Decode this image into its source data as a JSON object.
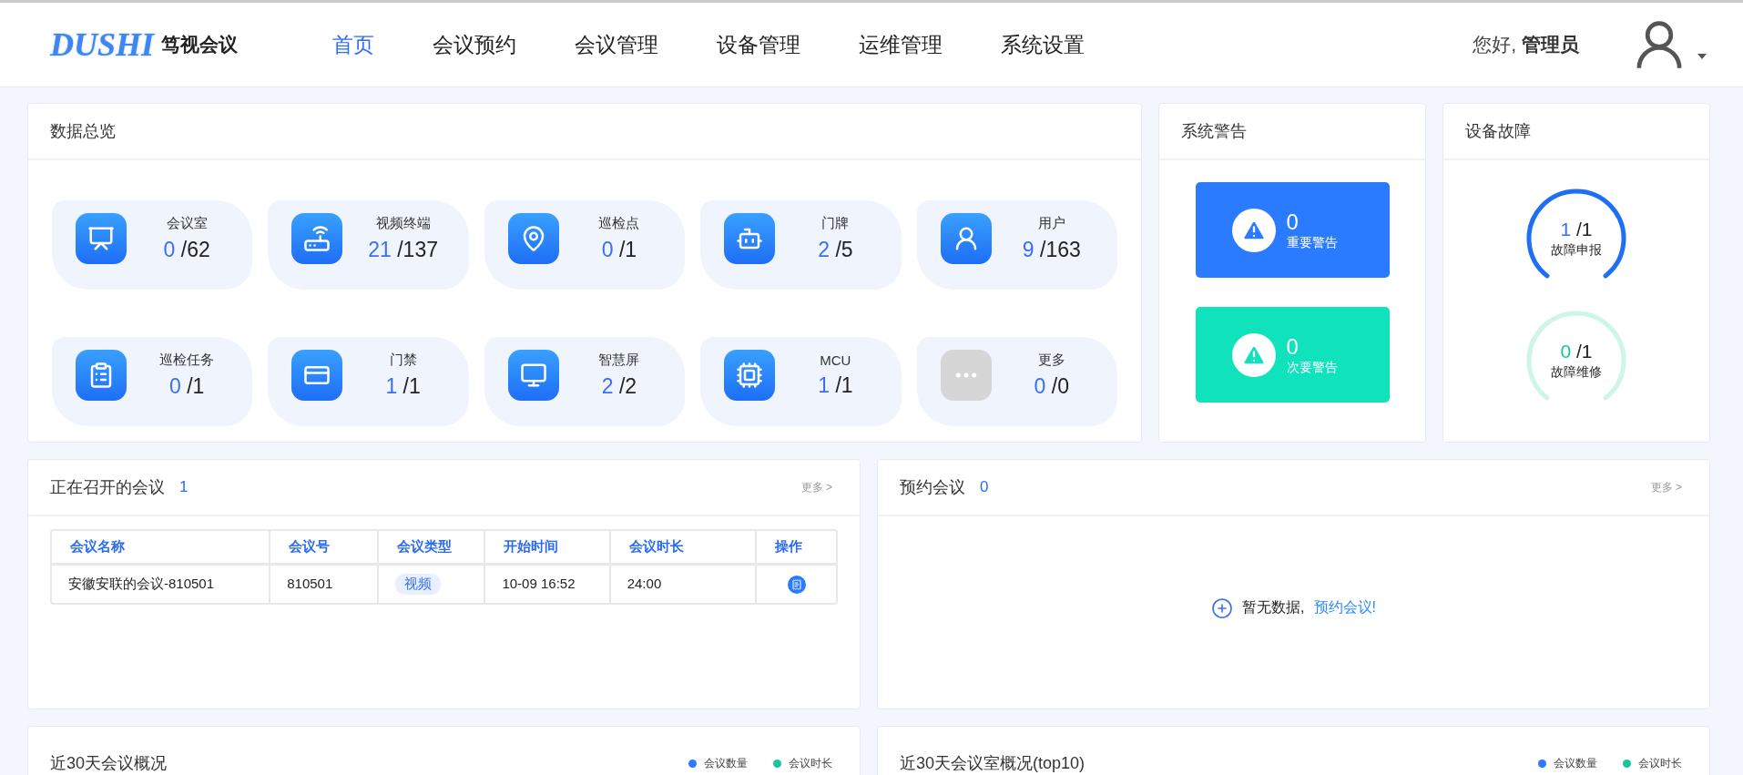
{
  "header": {
    "logo_mark": "DUSHI",
    "logo_text": "笃视会议",
    "nav": [
      {
        "label": "首页",
        "selected": true
      },
      {
        "label": "会议预约",
        "selected": false
      },
      {
        "label": "会议管理",
        "selected": false
      },
      {
        "label": "设备管理",
        "selected": false
      },
      {
        "label": "运维管理",
        "selected": false
      },
      {
        "label": "系统设置",
        "selected": false
      }
    ],
    "greeting": "您好,",
    "user": "管理员"
  },
  "overview": {
    "title": "数据总览",
    "stats": [
      {
        "kind": "room",
        "label": "会议室",
        "current": "0",
        "total": "/62"
      },
      {
        "kind": "terminal",
        "label": "视频终端",
        "current": "21",
        "total": "/137"
      },
      {
        "kind": "checkpoint",
        "label": "巡检点",
        "current": "0",
        "total": "/1"
      },
      {
        "kind": "doorplate",
        "label": "门牌",
        "current": "2",
        "total": "/5"
      },
      {
        "kind": "user",
        "label": "用户",
        "current": "9",
        "total": "/163"
      },
      {
        "kind": "task",
        "label": "巡检任务",
        "current": "0",
        "total": "/1"
      },
      {
        "kind": "access",
        "label": "门禁",
        "current": "1",
        "total": "/1"
      },
      {
        "kind": "screen",
        "label": "智慧屏",
        "current": "2",
        "total": "/2"
      },
      {
        "kind": "mcu",
        "label": "MCU",
        "current": "1",
        "total": "/1"
      },
      {
        "kind": "more",
        "label": "更多",
        "current": "0",
        "total": "/0"
      }
    ]
  },
  "alerts": {
    "title": "系统警告",
    "items": [
      {
        "color": "#2a7bff",
        "count": "0",
        "label": "重要警告"
      },
      {
        "color": "#10e2bb",
        "count": "0",
        "label": "次要警告"
      }
    ]
  },
  "faults": {
    "title": "设备故障",
    "items": [
      {
        "kind": "report",
        "color": "#1f6ff5",
        "current": "1",
        "total": "/1",
        "label": "故障申报"
      },
      {
        "kind": "repair",
        "color": "#cdf5e8",
        "current": "0",
        "total": "/1",
        "label": "故障维修"
      }
    ]
  },
  "ongoing": {
    "title": "正在召开的会议",
    "count": "1",
    "more": "更多 >",
    "columns": [
      "会议名称",
      "会议号",
      "会议类型",
      "开始时间",
      "会议时长",
      "操作"
    ],
    "rows": [
      {
        "name": "安徽安联的会议-810501",
        "number": "810501",
        "type": "视频",
        "start": "10-09 16:52",
        "duration": "24:00"
      }
    ]
  },
  "booked": {
    "title": "预约会议",
    "count": "0",
    "more": "更多 >",
    "empty_text": "暂无数据,",
    "empty_link": "预约会议!"
  },
  "charts": [
    {
      "title": "近30天会议概况",
      "legend": [
        {
          "label": "会议数量",
          "color": "#2a7bff"
        },
        {
          "label": "会议时长",
          "color": "#16c79a"
        }
      ]
    },
    {
      "title": "近30天会议室概况(top10)",
      "legend": [
        {
          "label": "会议数量",
          "color": "#2a7bff"
        },
        {
          "label": "会议时长",
          "color": "#16c79a"
        }
      ]
    }
  ]
}
